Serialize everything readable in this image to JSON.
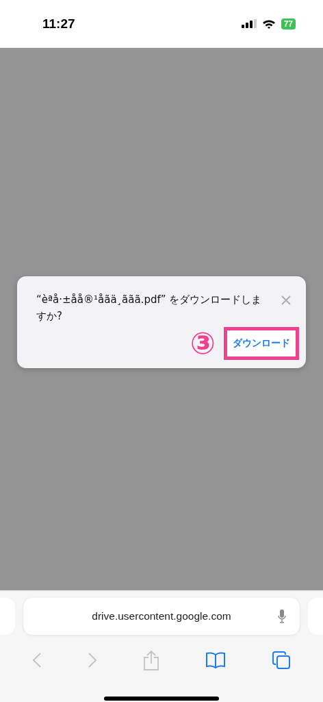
{
  "status_bar": {
    "time": "11:27",
    "battery": "77"
  },
  "dialog": {
    "message": "“èªå·±åå®¹åãä¸ããã.pdf” をダウンロードしますか?",
    "button": "ダウンロード",
    "annotation": "③",
    "highlighted": true
  },
  "address_bar": {
    "value": "drive.usercontent.google.com"
  },
  "toolbar": [
    {
      "kind": "back",
      "disabled": true
    },
    {
      "kind": "forward",
      "disabled": true
    },
    {
      "kind": "share",
      "disabled": true
    },
    {
      "kind": "bookmarks",
      "disabled": false
    },
    {
      "kind": "tabs",
      "disabled": false
    }
  ]
}
